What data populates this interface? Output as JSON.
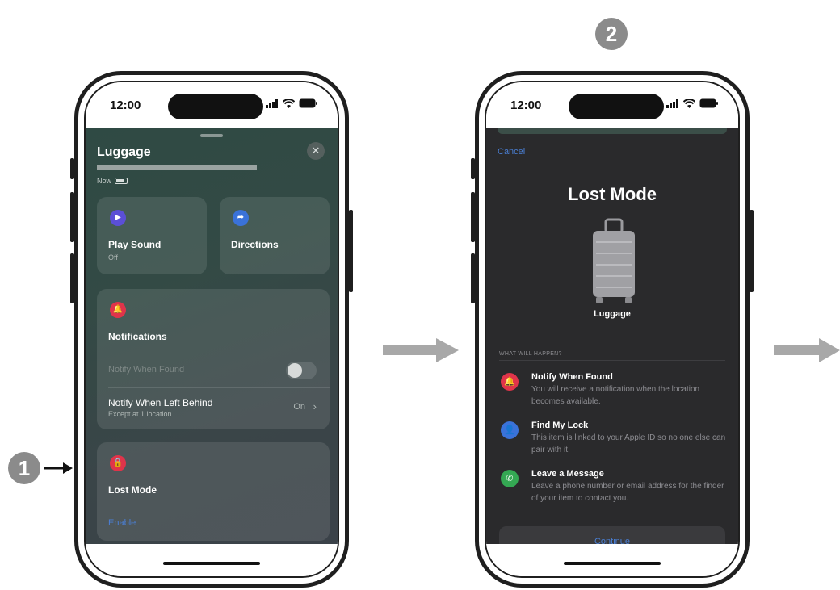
{
  "steps": {
    "one": "1",
    "two": "2"
  },
  "status": {
    "time": "12:00"
  },
  "screen1": {
    "title": "Luggage",
    "close_label": "✕",
    "location_status": "Now",
    "play_sound": {
      "label": "Play Sound",
      "sub": "Off",
      "icon": "play-icon",
      "color": "#5b4fd6"
    },
    "directions": {
      "label": "Directions",
      "icon": "directions-icon",
      "color": "#3a72d9"
    },
    "notifications": {
      "label": "Notifications",
      "icon": "bell-icon",
      "color": "#e0344a",
      "notify_when_found": "Notify When Found",
      "notify_when_left_behind": "Notify When Left Behind",
      "left_behind_sub": "Except at 1 location",
      "left_behind_value": "On"
    },
    "lost_mode": {
      "label": "Lost Mode",
      "action": "Enable",
      "icon": "lock-icon",
      "color": "#e0344a"
    }
  },
  "screen2": {
    "cancel": "Cancel",
    "title": "Lost Mode",
    "item_name": "Luggage",
    "section_label": "WHAT WILL HAPPEN?",
    "items": [
      {
        "title": "Notify When Found",
        "desc": "You will receive a notification when the location becomes available.",
        "icon": "bell-icon",
        "color": "#e0344a"
      },
      {
        "title": "Find My Lock",
        "desc": "This item is linked to your Apple ID so no one else can pair with it.",
        "icon": "person-icon",
        "color": "#3a72d9"
      },
      {
        "title": "Leave a Message",
        "desc": "Leave a phone number or email address for the finder of your item to contact you.",
        "icon": "phone-icon",
        "color": "#34a853"
      }
    ],
    "continue": "Continue"
  },
  "colors": {
    "accent_blue": "#4a7fd4",
    "badge_gray": "#8b8b8b"
  }
}
